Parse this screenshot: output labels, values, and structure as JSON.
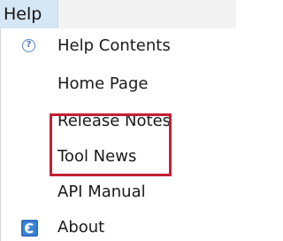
{
  "menubar": {
    "active_menu": "Help"
  },
  "menu": {
    "items": [
      {
        "label": "Help Contents",
        "icon": "help-circle-icon"
      },
      {
        "label": "Home Page"
      },
      {
        "label": "Release Notes"
      },
      {
        "label": "Tool News"
      },
      {
        "label": "API Manual"
      },
      {
        "label": "About",
        "icon": "app-logo-icon"
      }
    ],
    "highlighted_items": [
      "Release Notes",
      "Tool News"
    ],
    "highlight_color": "#c42034"
  }
}
